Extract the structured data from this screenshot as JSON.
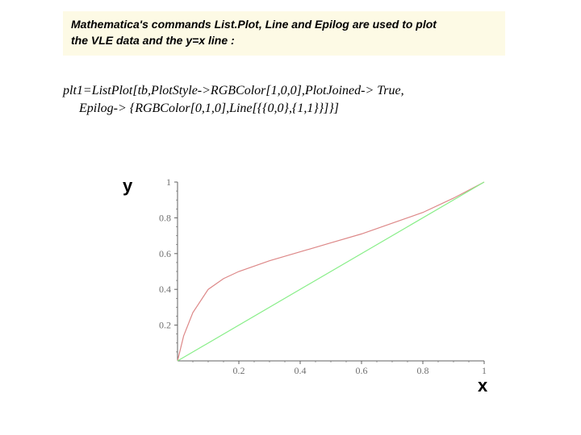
{
  "header": {
    "line1": "Mathematica's commands List.Plot, Line and Epilog are used to plot",
    "line2": "the VLE data and the y=x line :"
  },
  "code": {
    "line1": "plt1=ListPlot[tb,PlotStyle->RGBColor[1,0,0],PlotJoined-> True,",
    "line2": "Epilog-> {RGBColor[0,1,0],Line[{{0,0},{1,1}}]}]"
  },
  "axis_labels": {
    "x": "x",
    "y": "y"
  },
  "chart_data": {
    "type": "line",
    "title": "",
    "xlabel": "x",
    "ylabel": "y",
    "xlim": [
      0,
      1
    ],
    "ylim": [
      0,
      1
    ],
    "x_ticks": [
      0.2,
      0.4,
      0.6,
      0.8,
      1
    ],
    "y_ticks": [
      0.2,
      0.4,
      0.6,
      0.8,
      1
    ],
    "series": [
      {
        "name": "VLE data (red)",
        "color": "#d88",
        "x": [
          0.0,
          0.02,
          0.05,
          0.1,
          0.15,
          0.2,
          0.3,
          0.4,
          0.5,
          0.6,
          0.7,
          0.8,
          0.9,
          1.0
        ],
        "y": [
          0.0,
          0.14,
          0.27,
          0.4,
          0.46,
          0.5,
          0.56,
          0.61,
          0.66,
          0.71,
          0.77,
          0.83,
          0.91,
          1.0
        ]
      },
      {
        "name": "y = x (green)",
        "color": "#8e8",
        "x": [
          0.0,
          1.0
        ],
        "y": [
          0.0,
          1.0
        ]
      }
    ]
  }
}
